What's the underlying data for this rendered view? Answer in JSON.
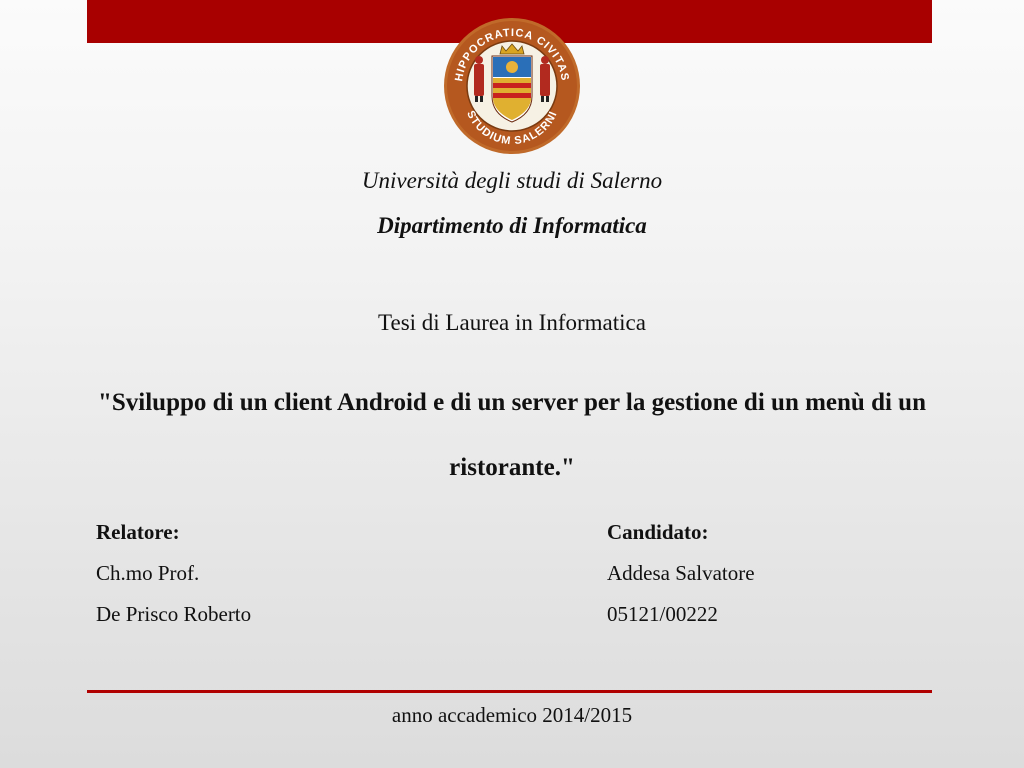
{
  "seal": {
    "text_top": "HIPPOCRATICA CIVITAS",
    "text_bottom": "STUDIUM SALERNI"
  },
  "header": {
    "university": "Università degli studi di Salerno",
    "department": "Dipartimento di Informatica"
  },
  "thesis": {
    "type": "Tesi di Laurea in Informatica",
    "title": "\"Sviluppo di un client Android e di un server per la gestione di un menù di un ristorante.\""
  },
  "supervisor": {
    "label": "Relatore:",
    "title": "Ch.mo Prof.",
    "name": "De Prisco Roberto"
  },
  "candidate": {
    "label": "Candidato:",
    "name": "Addesa Salvatore",
    "id": "05121/00222"
  },
  "footer": {
    "academic_year": "anno accademico 2014/2015"
  },
  "colors": {
    "accent": "#a80000",
    "seal_ring": "#b5581f",
    "seal_gold": "#e0b030"
  }
}
